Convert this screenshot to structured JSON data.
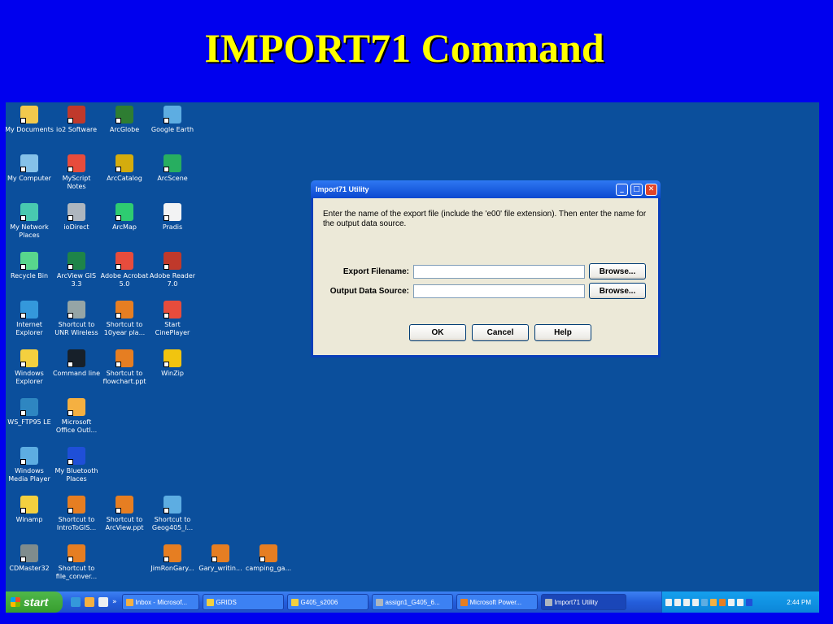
{
  "slide": {
    "title": "IMPORT71 Command"
  },
  "desktop_icons": [
    {
      "label": "My Documents",
      "color": "#F2C94C",
      "name": "my-documents-icon"
    },
    {
      "label": "io2 Software",
      "color": "#C0392B",
      "name": "io2-software-icon"
    },
    {
      "label": "ArcGlobe",
      "color": "#2E7D32",
      "name": "arcglobe-icon"
    },
    {
      "label": "Google Earth",
      "color": "#5DADE2",
      "name": "google-earth-icon"
    },
    {
      "label": "My Computer",
      "color": "#85C1E9",
      "name": "my-computer-icon"
    },
    {
      "label": "MyScript Notes",
      "color": "#E74C3C",
      "name": "myscript-notes-icon"
    },
    {
      "label": "ArcCatalog",
      "color": "#D4AC0D",
      "name": "arccatalog-icon"
    },
    {
      "label": "ArcScene",
      "color": "#27AE60",
      "name": "arcscene-icon"
    },
    {
      "label": "My Network Places",
      "color": "#48C9B0",
      "name": "my-network-places-icon"
    },
    {
      "label": "ioDirect",
      "color": "#AEB6BF",
      "name": "iodirect-icon"
    },
    {
      "label": "ArcMap",
      "color": "#2ECC71",
      "name": "arcmap-icon"
    },
    {
      "label": "Pradis",
      "color": "#F2F3F4",
      "name": "pradis-icon"
    },
    {
      "label": "Recycle Bin",
      "color": "#58D68D",
      "name": "recycle-bin-icon"
    },
    {
      "label": "ArcView GIS 3.3",
      "color": "#1E8449",
      "name": "arcview-gis-icon"
    },
    {
      "label": "Adobe Acrobat 5.0",
      "color": "#E74C3C",
      "name": "adobe-acrobat-icon"
    },
    {
      "label": "Adobe Reader 7.0",
      "color": "#C0392B",
      "name": "adobe-reader-icon"
    },
    {
      "label": "Internet Explorer",
      "color": "#3498DB",
      "name": "internet-explorer-icon"
    },
    {
      "label": "Shortcut to UNR Wireless",
      "color": "#95A5A6",
      "name": "unr-wireless-icon"
    },
    {
      "label": "Shortcut to 10year pla...",
      "color": "#E67E22",
      "name": "ppt-shortcut-icon"
    },
    {
      "label": "Start CinePlayer",
      "color": "#E74C3C",
      "name": "cineplayer-icon"
    },
    {
      "label": "Windows Explorer",
      "color": "#F4D03F",
      "name": "windows-explorer-icon"
    },
    {
      "label": "Command line",
      "color": "#17202A",
      "name": "command-line-icon"
    },
    {
      "label": "Shortcut to flowchart.ppt",
      "color": "#E67E22",
      "name": "ppt-shortcut-icon"
    },
    {
      "label": "WinZip",
      "color": "#F1C40F",
      "name": "winzip-icon"
    },
    {
      "label": "WS_FTP95 LE",
      "color": "#2E86C1",
      "name": "ws-ftp-icon"
    },
    {
      "label": "Microsoft Office Outl...",
      "color": "#F5B041",
      "name": "outlook-icon"
    },
    {
      "label": "Windows Media Player",
      "color": "#5DADE2",
      "name": "media-player-icon"
    },
    {
      "label": "My Bluetooth Places",
      "color": "#1F4FD8",
      "name": "bluetooth-icon"
    },
    {
      "label": "Winamp",
      "color": "#F4D03F",
      "name": "winamp-icon"
    },
    {
      "label": "Shortcut to IntroToGIS...",
      "color": "#E67E22",
      "name": "ppt-shortcut-icon"
    },
    {
      "label": "Shortcut to ArcView.ppt",
      "color": "#E67E22",
      "name": "ppt-shortcut-icon"
    },
    {
      "label": "Shortcut to Geog405_l...",
      "color": "#5DADE2",
      "name": "html-shortcut-icon"
    },
    {
      "label": "CDMaster32",
      "color": "#7F8C8D",
      "name": "cdmaster-icon"
    },
    {
      "label": "Shortcut to file_conver...",
      "color": "#E67E22",
      "name": "ppt-shortcut-icon"
    },
    {
      "label": "JimRonGary...",
      "color": "#E67E22",
      "name": "ppt-file-icon"
    },
    {
      "label": "Gary_writin...",
      "color": "#E67E22",
      "name": "ppt-file-icon"
    },
    {
      "label": "camping_ga...",
      "color": "#E67E22",
      "name": "ppt-file-icon"
    }
  ],
  "dialog": {
    "title": "Import71 Utility",
    "instructions": "Enter the name of the export file (include the 'e00' file extension). Then enter the name for the output data source.",
    "export_label": "Export Filename:",
    "export_value": "",
    "output_label": "Output Data Source:",
    "output_value": "",
    "browse_label": "Browse...",
    "ok_label": "OK",
    "cancel_label": "Cancel",
    "help_label": "Help",
    "minimize_glyph": "_",
    "maximize_glyph": "□",
    "close_glyph": "✕"
  },
  "taskbar": {
    "start_label": "start",
    "quicklaunch_more": "»",
    "tasks": [
      {
        "label": "Inbox - Microsof...",
        "color": "#F5B041",
        "name": "outlook-icon"
      },
      {
        "label": "GRIDS",
        "color": "#F4D03F",
        "name": "folder-icon"
      },
      {
        "label": "G405_s2006",
        "color": "#F4D03F",
        "name": "folder-icon"
      },
      {
        "label": "assign1_G405_6...",
        "color": "#AEB6BF",
        "name": "document-icon"
      },
      {
        "label": "Microsoft Power...",
        "color": "#E67E22",
        "name": "powerpoint-icon"
      },
      {
        "label": "Import71 Utility",
        "color": "#AEB6BF",
        "name": "utility-icon"
      }
    ],
    "clock": "2:44 PM"
  }
}
